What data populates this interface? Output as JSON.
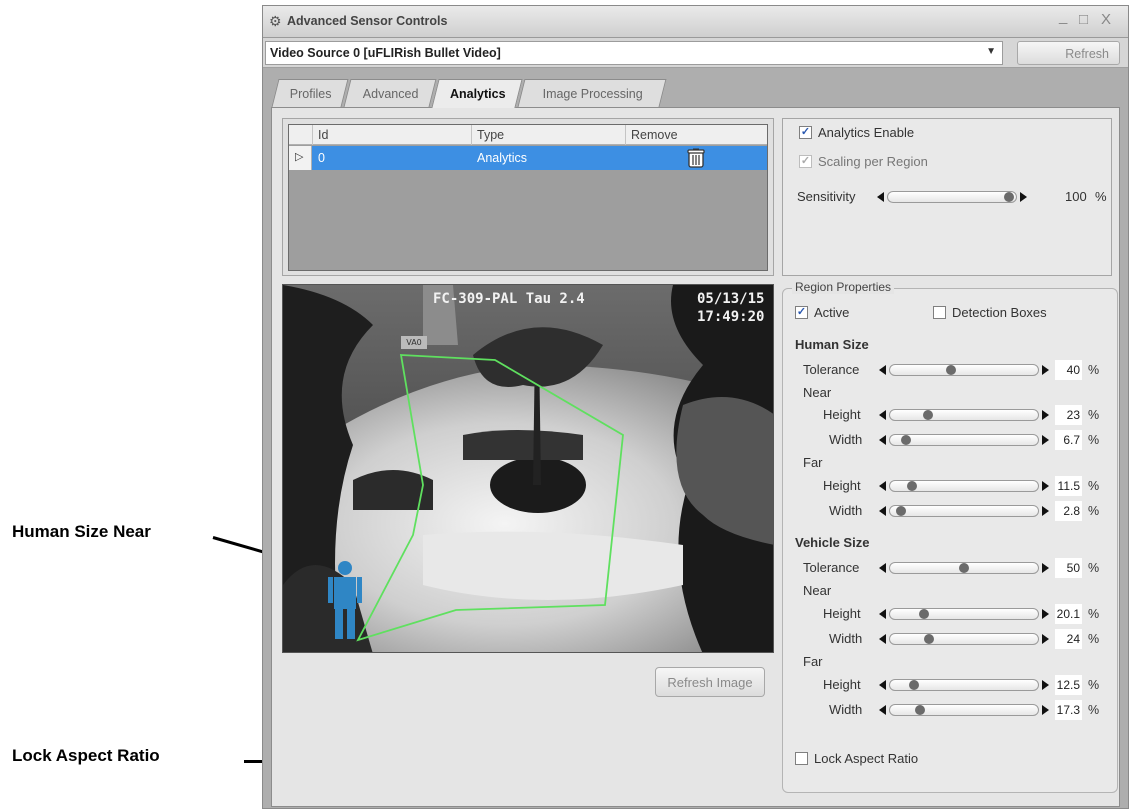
{
  "callouts": {
    "human_size_near": "Human Size Near",
    "lock_aspect_ratio": "Lock Aspect Ratio"
  },
  "window": {
    "title": "Advanced Sensor Controls",
    "controls": {
      "minimize": "_",
      "maximize": "□",
      "close": "X"
    },
    "icon": "gear-icon"
  },
  "source": {
    "selected": "Video Source 0 [uFLIRish Bullet Video]",
    "refresh_label": "Refresh"
  },
  "tabs": [
    {
      "label": "Profiles",
      "active": false
    },
    {
      "label": "Advanced",
      "active": false
    },
    {
      "label": "Analytics",
      "active": true
    },
    {
      "label": "Image Processing",
      "active": false
    }
  ],
  "regions_table": {
    "columns": {
      "id": "Id",
      "type": "Type",
      "remove": "Remove"
    },
    "rows": [
      {
        "id": "0",
        "type": "Analytics",
        "selected": true
      }
    ]
  },
  "analytics": {
    "enable_label": "Analytics Enable",
    "enable_checked": true,
    "scaling_label": "Scaling per Region",
    "scaling_checked": true,
    "sensitivity_label": "Sensitivity",
    "sensitivity_value": "100",
    "sensitivity_level": 1.0,
    "unit": "%"
  },
  "camera": {
    "header": "FC-309-PAL Tau 2.4",
    "date": "05/13/15",
    "time": "17:49:20",
    "tag": "VA0"
  },
  "refresh_image_label": "Refresh Image",
  "region": {
    "legend": "Region Properties",
    "active_label": "Active",
    "active_checked": true,
    "detection_boxes_label": "Detection Boxes",
    "detection_boxes_checked": false,
    "human_title": "Human Size",
    "vehicle_title": "Vehicle Size",
    "tolerance_label": "Tolerance",
    "near_label": "Near",
    "far_label": "Far",
    "height_label": "Height",
    "width_label": "Width",
    "unit": "%",
    "human": {
      "tolerance": "40",
      "near_height": "23",
      "near_width": "6.7",
      "far_height": "11.5",
      "far_width": "2.8"
    },
    "vehicle": {
      "tolerance": "50",
      "near_height": "20.1",
      "near_width": "24",
      "far_height": "12.5",
      "far_width": "17.3"
    },
    "levels": {
      "human_tolerance": 0.4,
      "human_near_height": 0.23,
      "human_near_width": 0.067,
      "human_far_height": 0.115,
      "human_far_width": 0.028,
      "vehicle_tolerance": 0.5,
      "vehicle_near_height": 0.201,
      "vehicle_near_width": 0.24,
      "vehicle_far_height": 0.125,
      "vehicle_far_width": 0.173
    },
    "lock_aspect_label": "Lock Aspect Ratio",
    "lock_aspect_checked": false
  }
}
